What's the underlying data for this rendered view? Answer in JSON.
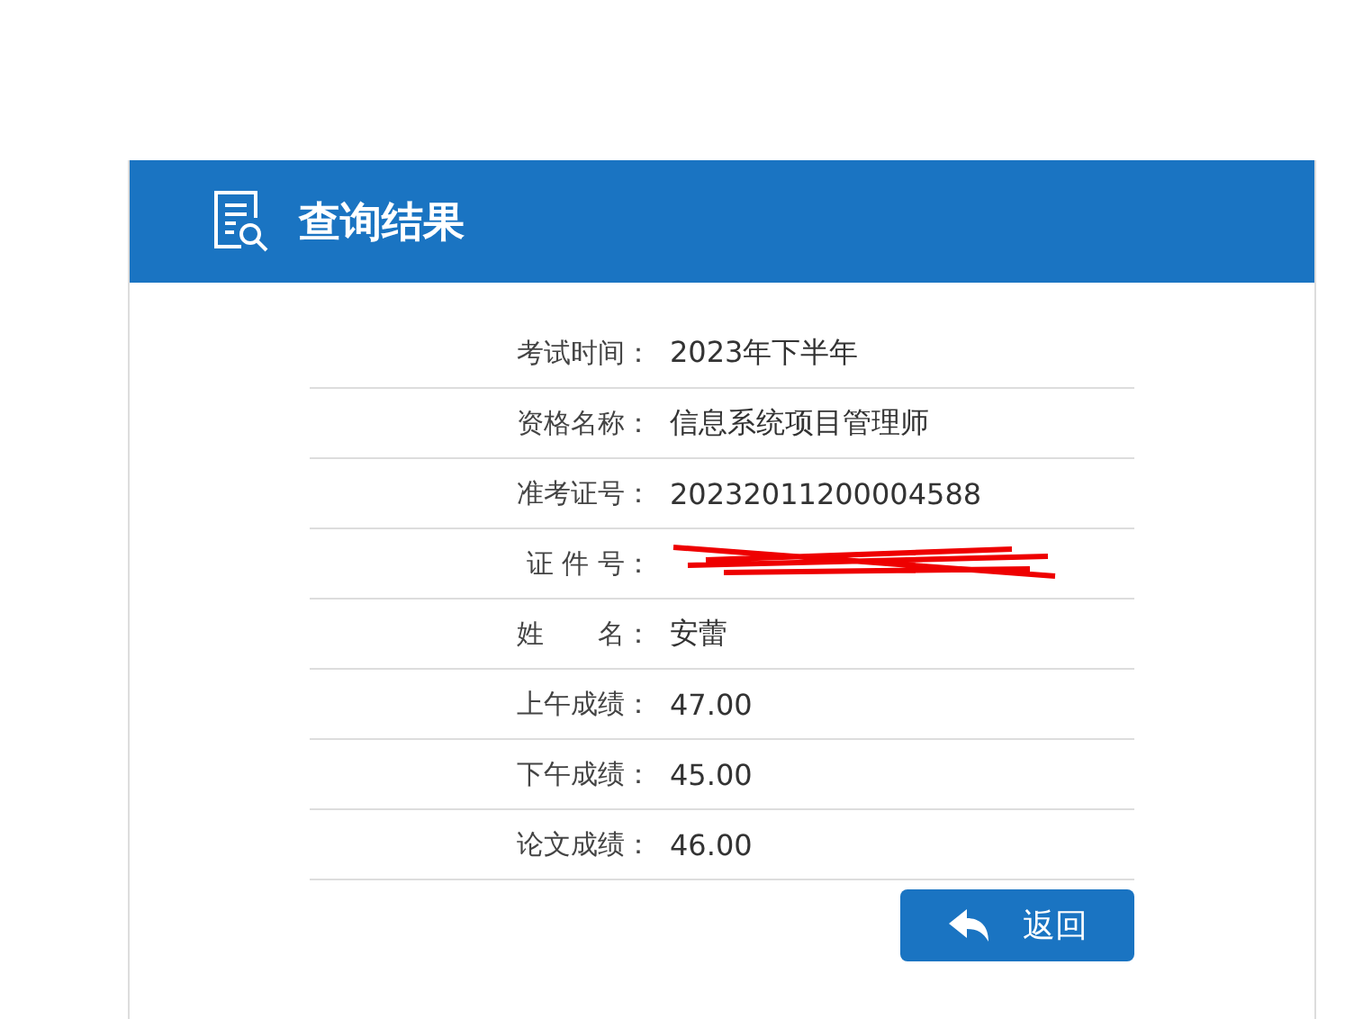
{
  "panel": {
    "title": "查询结果"
  },
  "rows": [
    {
      "label": "考试时间：",
      "value": "2023年下半年",
      "kind": "text"
    },
    {
      "label": "资格名称：",
      "value": "信息系统项目管理师",
      "kind": "text"
    },
    {
      "label": "准考证号：",
      "value": "20232011200004588",
      "kind": "text"
    },
    {
      "label": "证 件 号：",
      "kind": "redacted"
    },
    {
      "label": "姓　　名：",
      "value": "安蕾",
      "kind": "text"
    },
    {
      "label": "上午成绩：",
      "value": "47.00",
      "kind": "text"
    },
    {
      "label": "下午成绩：",
      "value": "45.00",
      "kind": "text"
    },
    {
      "label": "论文成绩：",
      "value": "46.00",
      "kind": "text"
    }
  ],
  "back_button": {
    "label": "返回"
  }
}
